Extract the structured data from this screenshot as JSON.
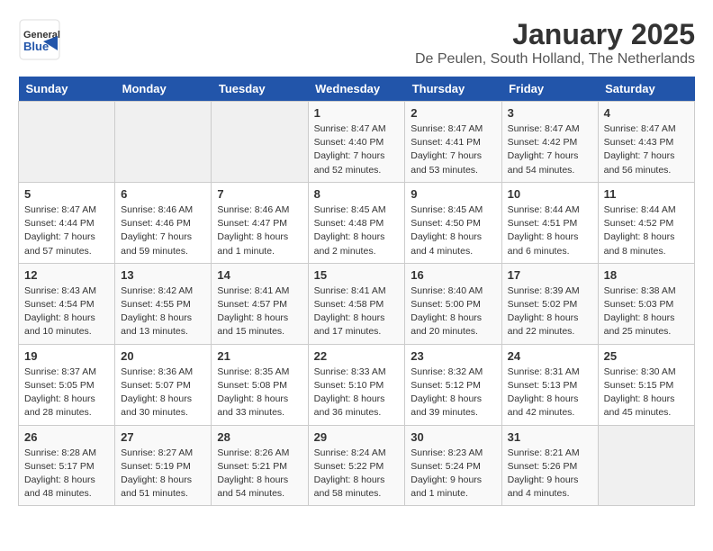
{
  "header": {
    "logo_general": "General",
    "logo_blue": "Blue",
    "title": "January 2025",
    "subtitle": "De Peulen, South Holland, The Netherlands"
  },
  "days_of_week": [
    "Sunday",
    "Monday",
    "Tuesday",
    "Wednesday",
    "Thursday",
    "Friday",
    "Saturday"
  ],
  "weeks": [
    [
      {
        "day": "",
        "info": ""
      },
      {
        "day": "",
        "info": ""
      },
      {
        "day": "",
        "info": ""
      },
      {
        "day": "1",
        "info": "Sunrise: 8:47 AM\nSunset: 4:40 PM\nDaylight: 7 hours and 52 minutes."
      },
      {
        "day": "2",
        "info": "Sunrise: 8:47 AM\nSunset: 4:41 PM\nDaylight: 7 hours and 53 minutes."
      },
      {
        "day": "3",
        "info": "Sunrise: 8:47 AM\nSunset: 4:42 PM\nDaylight: 7 hours and 54 minutes."
      },
      {
        "day": "4",
        "info": "Sunrise: 8:47 AM\nSunset: 4:43 PM\nDaylight: 7 hours and 56 minutes."
      }
    ],
    [
      {
        "day": "5",
        "info": "Sunrise: 8:47 AM\nSunset: 4:44 PM\nDaylight: 7 hours and 57 minutes."
      },
      {
        "day": "6",
        "info": "Sunrise: 8:46 AM\nSunset: 4:46 PM\nDaylight: 7 hours and 59 minutes."
      },
      {
        "day": "7",
        "info": "Sunrise: 8:46 AM\nSunset: 4:47 PM\nDaylight: 8 hours and 1 minute."
      },
      {
        "day": "8",
        "info": "Sunrise: 8:45 AM\nSunset: 4:48 PM\nDaylight: 8 hours and 2 minutes."
      },
      {
        "day": "9",
        "info": "Sunrise: 8:45 AM\nSunset: 4:50 PM\nDaylight: 8 hours and 4 minutes."
      },
      {
        "day": "10",
        "info": "Sunrise: 8:44 AM\nSunset: 4:51 PM\nDaylight: 8 hours and 6 minutes."
      },
      {
        "day": "11",
        "info": "Sunrise: 8:44 AM\nSunset: 4:52 PM\nDaylight: 8 hours and 8 minutes."
      }
    ],
    [
      {
        "day": "12",
        "info": "Sunrise: 8:43 AM\nSunset: 4:54 PM\nDaylight: 8 hours and 10 minutes."
      },
      {
        "day": "13",
        "info": "Sunrise: 8:42 AM\nSunset: 4:55 PM\nDaylight: 8 hours and 13 minutes."
      },
      {
        "day": "14",
        "info": "Sunrise: 8:41 AM\nSunset: 4:57 PM\nDaylight: 8 hours and 15 minutes."
      },
      {
        "day": "15",
        "info": "Sunrise: 8:41 AM\nSunset: 4:58 PM\nDaylight: 8 hours and 17 minutes."
      },
      {
        "day": "16",
        "info": "Sunrise: 8:40 AM\nSunset: 5:00 PM\nDaylight: 8 hours and 20 minutes."
      },
      {
        "day": "17",
        "info": "Sunrise: 8:39 AM\nSunset: 5:02 PM\nDaylight: 8 hours and 22 minutes."
      },
      {
        "day": "18",
        "info": "Sunrise: 8:38 AM\nSunset: 5:03 PM\nDaylight: 8 hours and 25 minutes."
      }
    ],
    [
      {
        "day": "19",
        "info": "Sunrise: 8:37 AM\nSunset: 5:05 PM\nDaylight: 8 hours and 28 minutes."
      },
      {
        "day": "20",
        "info": "Sunrise: 8:36 AM\nSunset: 5:07 PM\nDaylight: 8 hours and 30 minutes."
      },
      {
        "day": "21",
        "info": "Sunrise: 8:35 AM\nSunset: 5:08 PM\nDaylight: 8 hours and 33 minutes."
      },
      {
        "day": "22",
        "info": "Sunrise: 8:33 AM\nSunset: 5:10 PM\nDaylight: 8 hours and 36 minutes."
      },
      {
        "day": "23",
        "info": "Sunrise: 8:32 AM\nSunset: 5:12 PM\nDaylight: 8 hours and 39 minutes."
      },
      {
        "day": "24",
        "info": "Sunrise: 8:31 AM\nSunset: 5:13 PM\nDaylight: 8 hours and 42 minutes."
      },
      {
        "day": "25",
        "info": "Sunrise: 8:30 AM\nSunset: 5:15 PM\nDaylight: 8 hours and 45 minutes."
      }
    ],
    [
      {
        "day": "26",
        "info": "Sunrise: 8:28 AM\nSunset: 5:17 PM\nDaylight: 8 hours and 48 minutes."
      },
      {
        "day": "27",
        "info": "Sunrise: 8:27 AM\nSunset: 5:19 PM\nDaylight: 8 hours and 51 minutes."
      },
      {
        "day": "28",
        "info": "Sunrise: 8:26 AM\nSunset: 5:21 PM\nDaylight: 8 hours and 54 minutes."
      },
      {
        "day": "29",
        "info": "Sunrise: 8:24 AM\nSunset: 5:22 PM\nDaylight: 8 hours and 58 minutes."
      },
      {
        "day": "30",
        "info": "Sunrise: 8:23 AM\nSunset: 5:24 PM\nDaylight: 9 hours and 1 minute."
      },
      {
        "day": "31",
        "info": "Sunrise: 8:21 AM\nSunset: 5:26 PM\nDaylight: 9 hours and 4 minutes."
      },
      {
        "day": "",
        "info": ""
      }
    ]
  ]
}
